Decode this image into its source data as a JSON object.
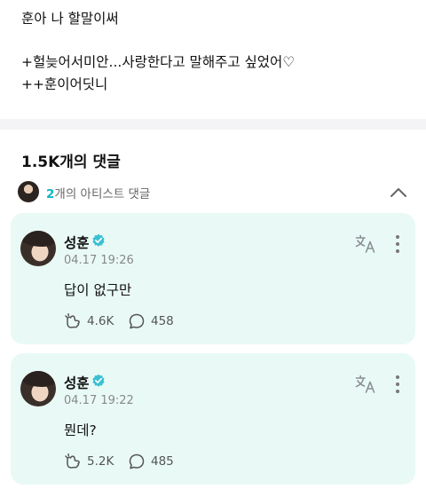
{
  "post": {
    "lines": [
      "훈아 나 할말이써",
      "+헐늦어서미안...사랑한다고 말해주고 싶었어♡",
      "++훈이어딧니"
    ]
  },
  "comments_section": {
    "header": "1.5K개의 댓글",
    "artist_comments": {
      "count": "2",
      "label": "개의 아티스트 댓글"
    }
  },
  "comments": [
    {
      "author": "성훈",
      "timestamp": "04.17 19:26",
      "text": "답이 없구만",
      "likes": "4.6K",
      "replies": "458"
    },
    {
      "author": "성훈",
      "timestamp": "04.17 19:22",
      "text": "뭔데?",
      "likes": "5.2K",
      "replies": "485"
    }
  ],
  "colors": {
    "card_background": "#e9faf6",
    "accent": "#0fb5c8",
    "verified": "#3ac0d3"
  },
  "icons": [
    "verified-badge-icon",
    "translate-icon",
    "more-vertical-icon",
    "like-icon",
    "reply-bubble-icon",
    "chevron-up-icon"
  ]
}
